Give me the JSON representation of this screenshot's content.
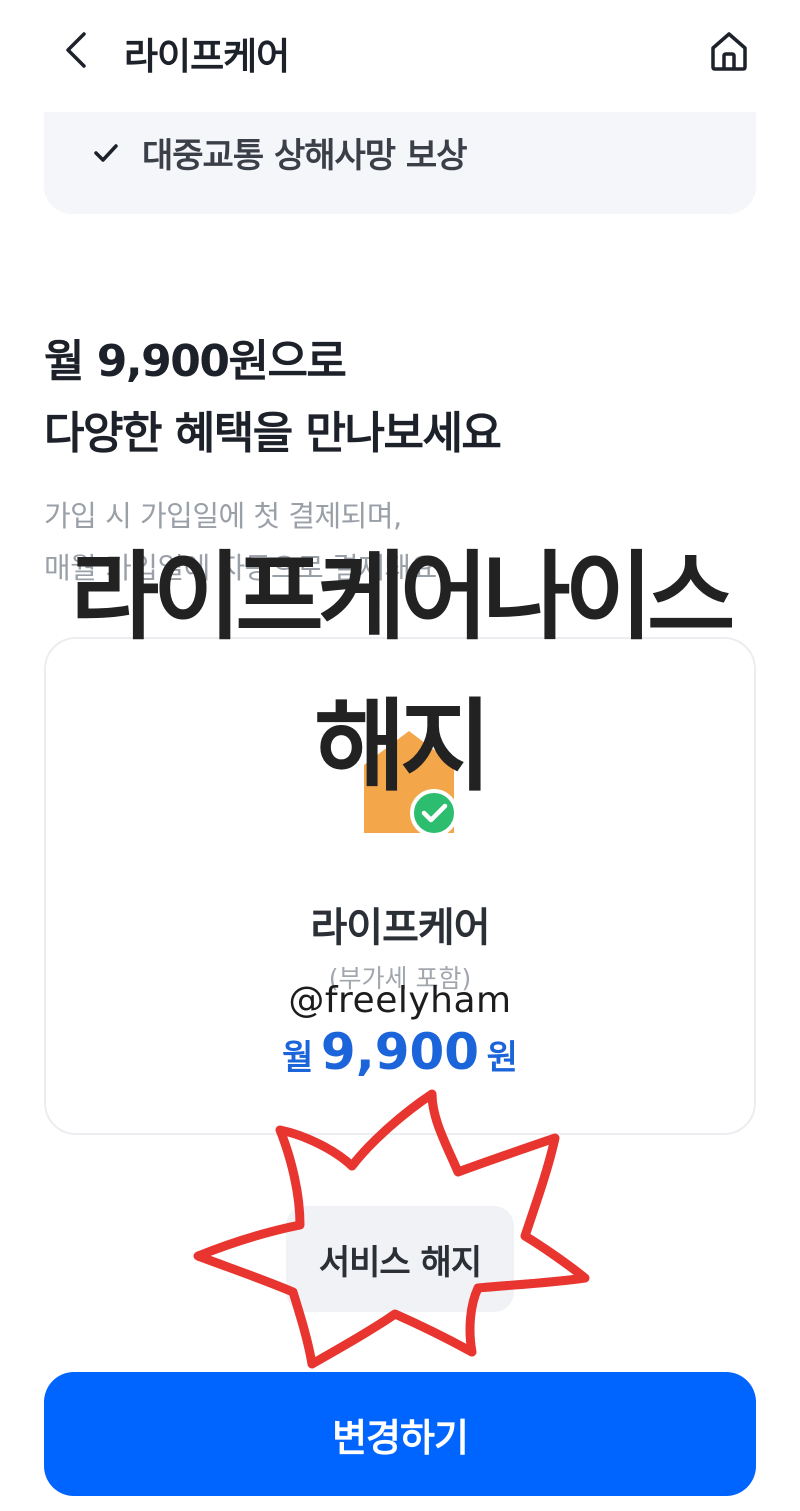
{
  "header": {
    "title": "라이프케어",
    "back_icon": "chevron-left-icon",
    "home_icon": "home-icon"
  },
  "benefit": {
    "text": "대중교통 상해사망 보상",
    "icon": "check-icon"
  },
  "headline": {
    "line1": "월 9,900원으로",
    "line2": "다양한 혜택을 만나보세요"
  },
  "description": {
    "line1": "가입 시 가입일에 첫 결제되며,",
    "line2": "매월 가입일에 자동으로 결제돼요."
  },
  "plan": {
    "name": "라이프케어",
    "vat": "(부가세 포함)",
    "price_unit": "월",
    "price_amount": "9,900",
    "price_suffix": "원",
    "icon": "house-shield-icon",
    "badge_icon": "check-circle-icon"
  },
  "buttons": {
    "cancel_service": "서비스 해지",
    "change": "변경하기"
  },
  "overlay": {
    "title_line1": "라이프케어나이스",
    "title_line2": "해지",
    "watermark": "@freelyham"
  },
  "colors": {
    "primary": "#0064ff",
    "price": "#1b64da",
    "scribble": "#e8352f",
    "icon_orange": "#f4a64a",
    "badge_green": "#2dbd6e"
  }
}
